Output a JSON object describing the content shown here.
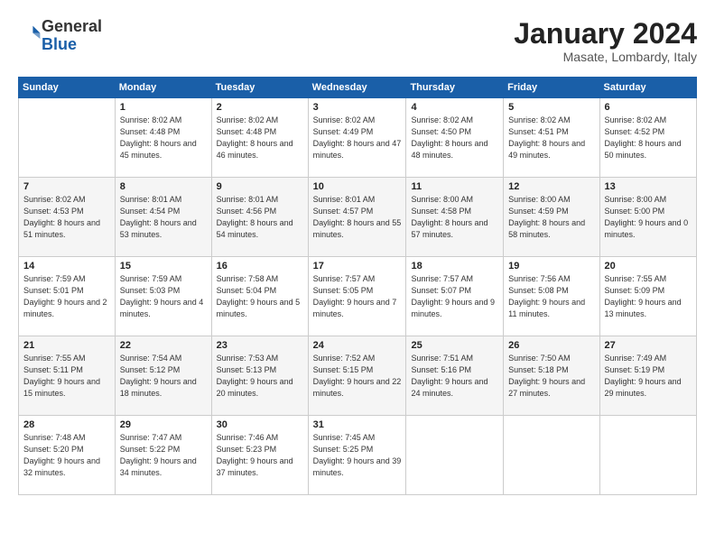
{
  "header": {
    "logo_general": "General",
    "logo_blue": "Blue",
    "month_title": "January 2024",
    "subtitle": "Masate, Lombardy, Italy"
  },
  "weekdays": [
    "Sunday",
    "Monday",
    "Tuesday",
    "Wednesday",
    "Thursday",
    "Friday",
    "Saturday"
  ],
  "weeks": [
    [
      {
        "day": "",
        "sunrise": "",
        "sunset": "",
        "daylight": ""
      },
      {
        "day": "1",
        "sunrise": "Sunrise: 8:02 AM",
        "sunset": "Sunset: 4:48 PM",
        "daylight": "Daylight: 8 hours and 45 minutes."
      },
      {
        "day": "2",
        "sunrise": "Sunrise: 8:02 AM",
        "sunset": "Sunset: 4:48 PM",
        "daylight": "Daylight: 8 hours and 46 minutes."
      },
      {
        "day": "3",
        "sunrise": "Sunrise: 8:02 AM",
        "sunset": "Sunset: 4:49 PM",
        "daylight": "Daylight: 8 hours and 47 minutes."
      },
      {
        "day": "4",
        "sunrise": "Sunrise: 8:02 AM",
        "sunset": "Sunset: 4:50 PM",
        "daylight": "Daylight: 8 hours and 48 minutes."
      },
      {
        "day": "5",
        "sunrise": "Sunrise: 8:02 AM",
        "sunset": "Sunset: 4:51 PM",
        "daylight": "Daylight: 8 hours and 49 minutes."
      },
      {
        "day": "6",
        "sunrise": "Sunrise: 8:02 AM",
        "sunset": "Sunset: 4:52 PM",
        "daylight": "Daylight: 8 hours and 50 minutes."
      }
    ],
    [
      {
        "day": "7",
        "sunrise": "Sunrise: 8:02 AM",
        "sunset": "Sunset: 4:53 PM",
        "daylight": "Daylight: 8 hours and 51 minutes."
      },
      {
        "day": "8",
        "sunrise": "Sunrise: 8:01 AM",
        "sunset": "Sunset: 4:54 PM",
        "daylight": "Daylight: 8 hours and 53 minutes."
      },
      {
        "day": "9",
        "sunrise": "Sunrise: 8:01 AM",
        "sunset": "Sunset: 4:56 PM",
        "daylight": "Daylight: 8 hours and 54 minutes."
      },
      {
        "day": "10",
        "sunrise": "Sunrise: 8:01 AM",
        "sunset": "Sunset: 4:57 PM",
        "daylight": "Daylight: 8 hours and 55 minutes."
      },
      {
        "day": "11",
        "sunrise": "Sunrise: 8:00 AM",
        "sunset": "Sunset: 4:58 PM",
        "daylight": "Daylight: 8 hours and 57 minutes."
      },
      {
        "day": "12",
        "sunrise": "Sunrise: 8:00 AM",
        "sunset": "Sunset: 4:59 PM",
        "daylight": "Daylight: 8 hours and 58 minutes."
      },
      {
        "day": "13",
        "sunrise": "Sunrise: 8:00 AM",
        "sunset": "Sunset: 5:00 PM",
        "daylight": "Daylight: 9 hours and 0 minutes."
      }
    ],
    [
      {
        "day": "14",
        "sunrise": "Sunrise: 7:59 AM",
        "sunset": "Sunset: 5:01 PM",
        "daylight": "Daylight: 9 hours and 2 minutes."
      },
      {
        "day": "15",
        "sunrise": "Sunrise: 7:59 AM",
        "sunset": "Sunset: 5:03 PM",
        "daylight": "Daylight: 9 hours and 4 minutes."
      },
      {
        "day": "16",
        "sunrise": "Sunrise: 7:58 AM",
        "sunset": "Sunset: 5:04 PM",
        "daylight": "Daylight: 9 hours and 5 minutes."
      },
      {
        "day": "17",
        "sunrise": "Sunrise: 7:57 AM",
        "sunset": "Sunset: 5:05 PM",
        "daylight": "Daylight: 9 hours and 7 minutes."
      },
      {
        "day": "18",
        "sunrise": "Sunrise: 7:57 AM",
        "sunset": "Sunset: 5:07 PM",
        "daylight": "Daylight: 9 hours and 9 minutes."
      },
      {
        "day": "19",
        "sunrise": "Sunrise: 7:56 AM",
        "sunset": "Sunset: 5:08 PM",
        "daylight": "Daylight: 9 hours and 11 minutes."
      },
      {
        "day": "20",
        "sunrise": "Sunrise: 7:55 AM",
        "sunset": "Sunset: 5:09 PM",
        "daylight": "Daylight: 9 hours and 13 minutes."
      }
    ],
    [
      {
        "day": "21",
        "sunrise": "Sunrise: 7:55 AM",
        "sunset": "Sunset: 5:11 PM",
        "daylight": "Daylight: 9 hours and 15 minutes."
      },
      {
        "day": "22",
        "sunrise": "Sunrise: 7:54 AM",
        "sunset": "Sunset: 5:12 PM",
        "daylight": "Daylight: 9 hours and 18 minutes."
      },
      {
        "day": "23",
        "sunrise": "Sunrise: 7:53 AM",
        "sunset": "Sunset: 5:13 PM",
        "daylight": "Daylight: 9 hours and 20 minutes."
      },
      {
        "day": "24",
        "sunrise": "Sunrise: 7:52 AM",
        "sunset": "Sunset: 5:15 PM",
        "daylight": "Daylight: 9 hours and 22 minutes."
      },
      {
        "day": "25",
        "sunrise": "Sunrise: 7:51 AM",
        "sunset": "Sunset: 5:16 PM",
        "daylight": "Daylight: 9 hours and 24 minutes."
      },
      {
        "day": "26",
        "sunrise": "Sunrise: 7:50 AM",
        "sunset": "Sunset: 5:18 PM",
        "daylight": "Daylight: 9 hours and 27 minutes."
      },
      {
        "day": "27",
        "sunrise": "Sunrise: 7:49 AM",
        "sunset": "Sunset: 5:19 PM",
        "daylight": "Daylight: 9 hours and 29 minutes."
      }
    ],
    [
      {
        "day": "28",
        "sunrise": "Sunrise: 7:48 AM",
        "sunset": "Sunset: 5:20 PM",
        "daylight": "Daylight: 9 hours and 32 minutes."
      },
      {
        "day": "29",
        "sunrise": "Sunrise: 7:47 AM",
        "sunset": "Sunset: 5:22 PM",
        "daylight": "Daylight: 9 hours and 34 minutes."
      },
      {
        "day": "30",
        "sunrise": "Sunrise: 7:46 AM",
        "sunset": "Sunset: 5:23 PM",
        "daylight": "Daylight: 9 hours and 37 minutes."
      },
      {
        "day": "31",
        "sunrise": "Sunrise: 7:45 AM",
        "sunset": "Sunset: 5:25 PM",
        "daylight": "Daylight: 9 hours and 39 minutes."
      },
      {
        "day": "",
        "sunrise": "",
        "sunset": "",
        "daylight": ""
      },
      {
        "day": "",
        "sunrise": "",
        "sunset": "",
        "daylight": ""
      },
      {
        "day": "",
        "sunrise": "",
        "sunset": "",
        "daylight": ""
      }
    ]
  ]
}
